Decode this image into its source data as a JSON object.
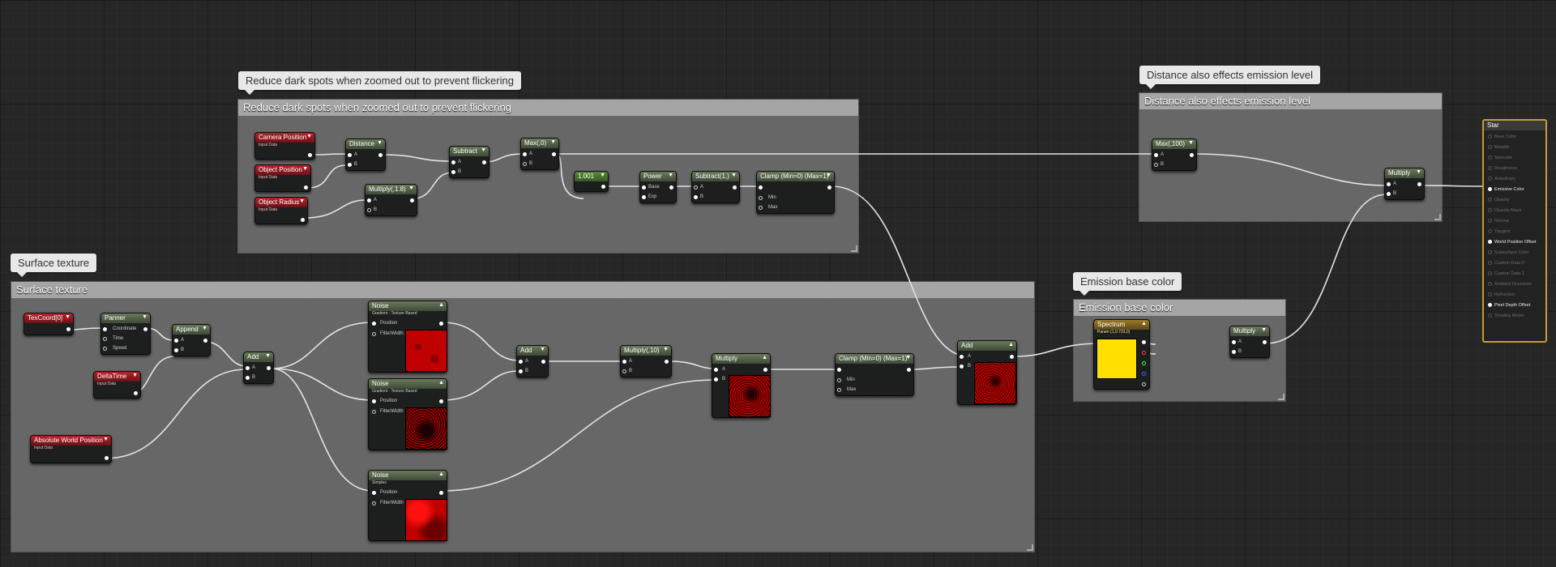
{
  "comments": {
    "reduce_dark": {
      "bubble": "Reduce dark spots when zoomed out to prevent flickering",
      "title": "Reduce dark spots when zoomed out to prevent flickering"
    },
    "distance_emission": {
      "bubble": "Distance also effects emission level",
      "title": "Distance also effects emission level"
    },
    "surface": {
      "bubble": "Surface texture",
      "title": "Surface texture"
    },
    "emission_base": {
      "bubble": "Emission base color",
      "title": "Emission base color"
    }
  },
  "nodes": {
    "camera_position": {
      "title": "Camera Position",
      "subtitle": "Input Data"
    },
    "object_position": {
      "title": "Object Position",
      "subtitle": "Input Data"
    },
    "object_radius": {
      "title": "Object Radius",
      "subtitle": "Input Data"
    },
    "distance": {
      "title": "Distance",
      "pins": [
        "A",
        "B"
      ]
    },
    "multiply_18": {
      "title": "Multiply(,1.8)",
      "pins": [
        "A",
        "B"
      ]
    },
    "subtract_1": {
      "title": "Subtract",
      "pins": [
        "A",
        "B"
      ]
    },
    "max_0": {
      "title": "Max(,0)",
      "pins": [
        "A",
        "B"
      ]
    },
    "const_001": {
      "title": "1.001"
    },
    "power": {
      "title": "Power",
      "pins": [
        "Base",
        "Exp"
      ]
    },
    "subtract_2": {
      "title": "Subtract(1,)",
      "pins": [
        "A",
        "B"
      ]
    },
    "clamp_1": {
      "title": "Clamp (Min=0) (Max=1)",
      "pins": [
        "",
        "Min",
        "Max"
      ]
    },
    "max_100": {
      "title": "Max(,100)",
      "pins": [
        "A",
        "B"
      ]
    },
    "multiply_final": {
      "title": "Multiply",
      "pins": [
        "A",
        "B"
      ]
    },
    "texcoord": {
      "title": "TexCoord[0]"
    },
    "panner": {
      "title": "Panner",
      "pins": [
        "Coordinate",
        "Time",
        "Speed"
      ]
    },
    "append": {
      "title": "Append",
      "pins": [
        "A",
        "B"
      ]
    },
    "delta_time": {
      "title": "DeltaTime",
      "subtitle": "Input Data"
    },
    "abs_world_pos": {
      "title": "Absolute World Position",
      "subtitle": "Input Data"
    },
    "add_1": {
      "title": "Add",
      "pins": [
        "A",
        "B"
      ]
    },
    "noise_1": {
      "title": "Noise",
      "subtitle": "Gradient - Texture Based",
      "pins": [
        "Position",
        "FilterWidth"
      ]
    },
    "noise_2": {
      "title": "Noise",
      "subtitle": "Gradient - Texture Based",
      "pins": [
        "Position",
        "FilterWidth"
      ]
    },
    "noise_3": {
      "title": "Noise",
      "subtitle": "Simplex",
      "pins": [
        "Position",
        "FilterWidth"
      ]
    },
    "add_2": {
      "title": "Add",
      "pins": [
        "A",
        "B"
      ]
    },
    "multiply_10": {
      "title": "Multiply(,10)",
      "pins": [
        "A",
        "B"
      ]
    },
    "multiply_2": {
      "title": "Multiply",
      "pins": [
        "A",
        "B"
      ]
    },
    "clamp_2": {
      "title": "Clamp (Min=0) (Max=1)",
      "pins": [
        "",
        "Min",
        "Max"
      ]
    },
    "add_3": {
      "title": "Add",
      "pins": [
        "A",
        "B"
      ]
    },
    "spectrum": {
      "title": "Spectrum",
      "subtitle": "Param (1,0.733,0)"
    },
    "multiply_3": {
      "title": "Multiply",
      "pins": [
        "A",
        "B"
      ]
    }
  },
  "material": {
    "title": "Star",
    "pins": [
      {
        "label": "Base Color",
        "active": false
      },
      {
        "label": "Metallic",
        "active": false
      },
      {
        "label": "Specular",
        "active": false
      },
      {
        "label": "Roughness",
        "active": false
      },
      {
        "label": "Anisotropy",
        "active": false
      },
      {
        "label": "Emissive Color",
        "active": true
      },
      {
        "label": "Opacity",
        "active": false
      },
      {
        "label": "Opacity Mask",
        "active": false
      },
      {
        "label": "Normal",
        "active": false
      },
      {
        "label": "Tangent",
        "active": false
      },
      {
        "label": "World Position Offset",
        "active": true
      },
      {
        "label": "Subsurface Color",
        "active": false
      },
      {
        "label": "Custom Data 0",
        "active": false
      },
      {
        "label": "Custom Data 1",
        "active": false
      },
      {
        "label": "Ambient Occlusion",
        "active": false
      },
      {
        "label": "Refraction",
        "active": false
      },
      {
        "label": "Pixel Depth Offset",
        "active": true
      },
      {
        "label": "Shading Model",
        "active": false
      }
    ]
  },
  "colors": {
    "spectrum": "#ffe000",
    "material_border": "#c99a36",
    "noise": "#cc0000"
  }
}
